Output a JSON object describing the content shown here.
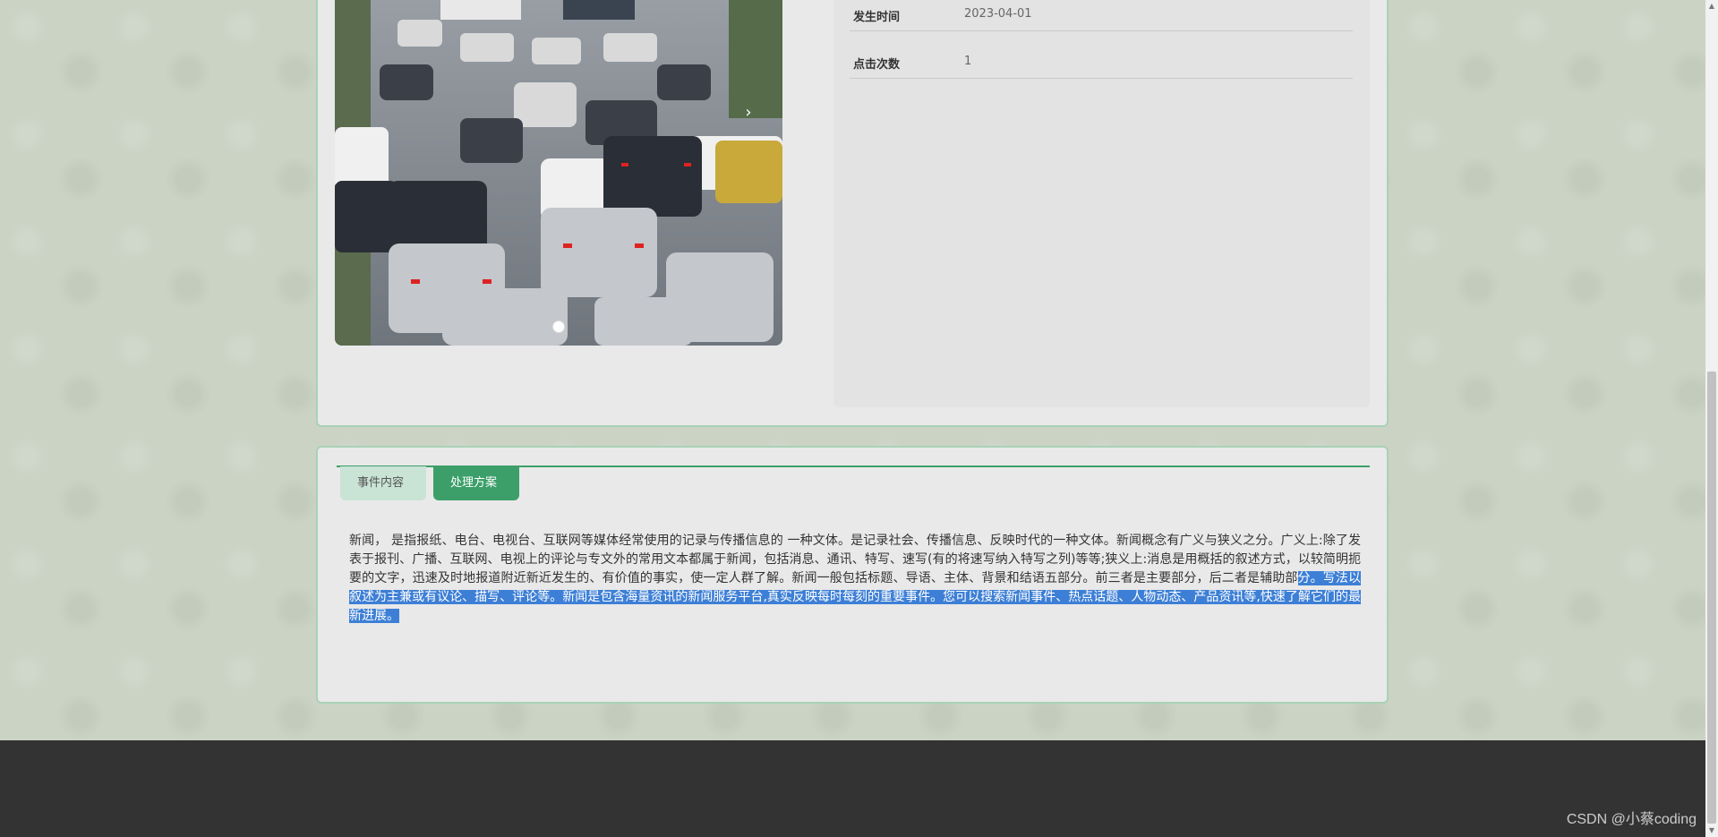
{
  "detail": {
    "fields": [
      {
        "label": "发生时间",
        "value": "2023-04-01"
      },
      {
        "label": "点击次数",
        "value": "1"
      }
    ]
  },
  "carousel": {
    "image_alt": "traffic-jam-photo",
    "next_icon": "chevron-right-icon",
    "total_slides": 1,
    "active_slide": 1
  },
  "tabs": [
    {
      "label": "事件内容",
      "active": false
    },
    {
      "label": "处理方案",
      "active": true
    }
  ],
  "content": {
    "normal_text": "新闻， 是指报纸、电台、电视台、互联网等媒体经常使用的记录与传播信息的 一种文体。是记录社会、传播信息、反映时代的一种文体。新闻概念有广义与狭义之分。广义上:除了发表于报刊、广播、互联网、电视上的评论与专文外的常用文本都属于新闻，包括消息、通讯、特写、速写(有的将速写纳入特写之列)等等;狭义上:消息是用概括的叙述方式，以较简明扼要的文字，迅速及时地报道附近新近发生的、有价值的事实，使一定人群了解。新闻一般包括标题、导语、主体、背景和结语五部分。前三者是主要部分，后二者是辅助部",
    "selected_text": "分。写法以叙述为主兼或有议论、描写、评论等。新闻是包含海量资讯的新闻服务平台,真实反映每时每刻的重要事件。您可以搜索新闻事件、热点话题、人物动态、产品资讯等,快速了解它们的最新进展。"
  },
  "footer": {
    "watermark": "CSDN @小蔡coding"
  },
  "colors": {
    "accent": "#3c9f69",
    "tab_inactive": "#c9e3d5",
    "selection": "#3d7fd6",
    "footer": "#333333"
  }
}
